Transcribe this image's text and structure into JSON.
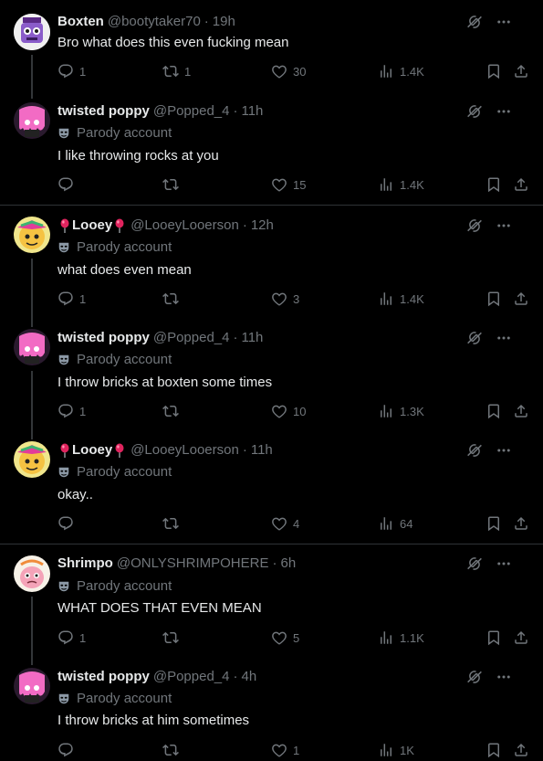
{
  "badge_label": "Parody account",
  "tweets": [
    {
      "name": "Boxten",
      "handle": "@bootytaker70",
      "time": "19h",
      "text": "Bro what does this even fucking mean",
      "replies": "1",
      "retweets": "1",
      "likes": "30",
      "views": "1.4K"
    },
    {
      "name": "twisted poppy",
      "handle": "@Popped_4",
      "time": "11h",
      "text": "I like throwing rocks at you",
      "replies": "",
      "retweets": "",
      "likes": "15",
      "views": "1.4K"
    },
    {
      "name": "Looey",
      "handle": "@LooeyLooerson",
      "time": "12h",
      "text": "what does even mean",
      "replies": "1",
      "retweets": "",
      "likes": "3",
      "views": "1.4K"
    },
    {
      "name": "twisted poppy",
      "handle": "@Popped_4",
      "time": "11h",
      "text": "I throw bricks at boxten some times",
      "replies": "1",
      "retweets": "",
      "likes": "10",
      "views": "1.3K"
    },
    {
      "name": "Looey",
      "handle": "@LooeyLooerson",
      "time": "11h",
      "text": "okay..",
      "replies": "",
      "retweets": "",
      "likes": "4",
      "views": "64"
    },
    {
      "name": "Shrimpo",
      "handle": "@ONLYSHRIMPOHERE",
      "time": "6h",
      "text": "WHAT DOES THAT EVEN MEAN",
      "replies": "1",
      "retweets": "",
      "likes": "5",
      "views": "1.1K"
    },
    {
      "name": "twisted poppy",
      "handle": "@Popped_4",
      "time": "4h",
      "text": "I throw bricks at him sometimes",
      "replies": "",
      "retweets": "",
      "likes": "1",
      "views": "1K"
    }
  ],
  "icons": {
    "reply": "reply-icon",
    "retweet": "retweet-icon",
    "like": "heart-icon",
    "views": "views-icon",
    "bookmark": "bookmark-icon",
    "share": "share-icon",
    "grok": "grok-icon",
    "more": "more-icon",
    "parody": "parody-mask-icon"
  },
  "colors": {
    "background": "#000000",
    "text": "#e7e9ea",
    "muted": "#71767b",
    "divider": "#2f3336",
    "balloon": "#e0245e"
  }
}
